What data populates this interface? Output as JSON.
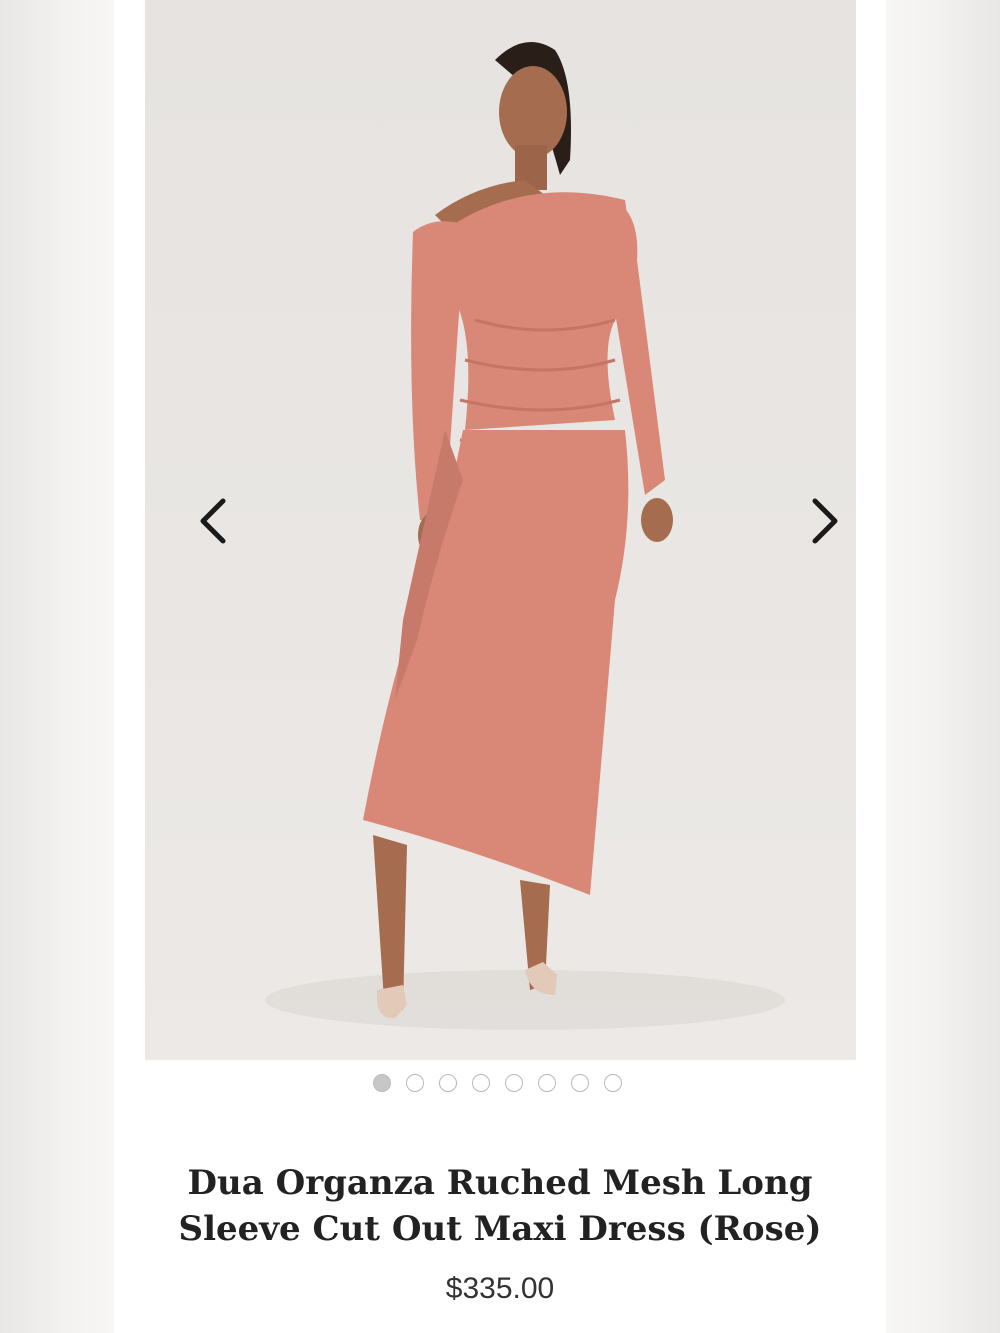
{
  "product": {
    "title": "Dua Organza Ruched Mesh Long Sleeve Cut Out Maxi Dress (Rose)",
    "price": "$335.00",
    "image_alt": "Model wearing rose ruched mesh maxi dress",
    "dress_color": "#d98877",
    "backdrop_color": "#e8e5e2"
  },
  "carousel": {
    "prev_icon": "chevron-left-icon",
    "next_icon": "chevron-right-icon",
    "slide_count": 8,
    "active_index": 0
  }
}
